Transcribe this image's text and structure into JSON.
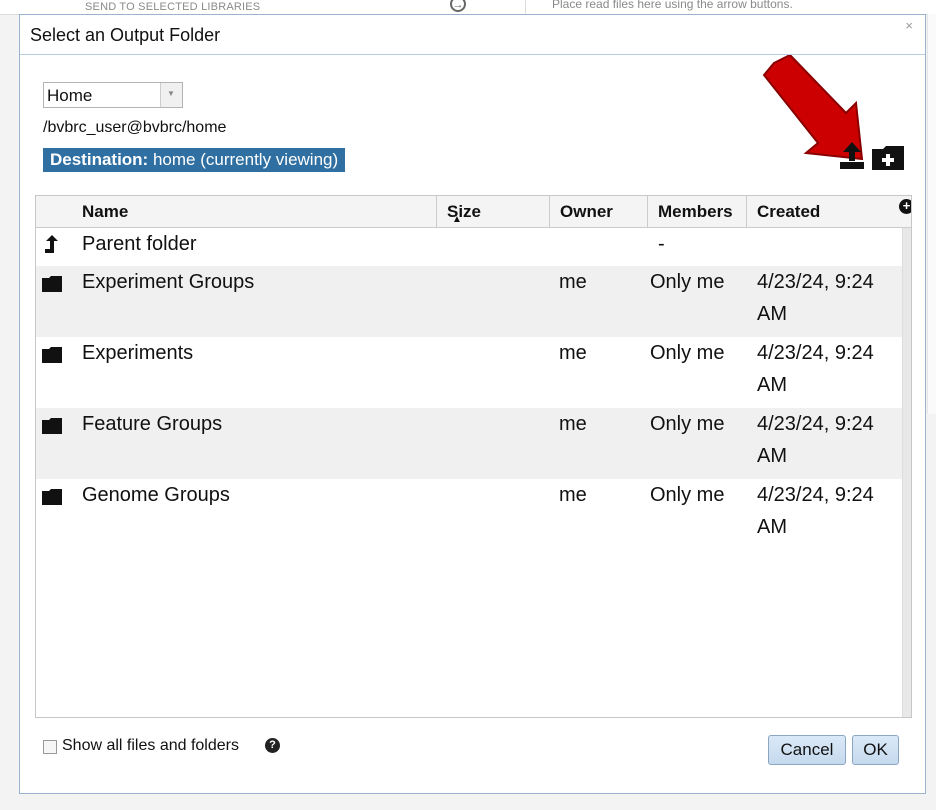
{
  "background": {
    "left_label": "SEND TO SELECTED LIBRARIES",
    "right_label": "Place read files here using the arrow buttons."
  },
  "dialog": {
    "title": "Select an Output Folder",
    "close_glyph": "×",
    "folder_select": {
      "value": "Home"
    },
    "path": "/bvbrc_user@bvbrc/home",
    "destination": {
      "label": "Destination:",
      "value": "home (currently viewing)"
    },
    "columns": [
      "Name",
      "Size",
      "Owner",
      "Members",
      "Created"
    ],
    "rows": [
      {
        "icon": "up-arrow-icon",
        "name": "Parent folder",
        "size": "",
        "owner": "",
        "members": "-",
        "created_1": "",
        "created_2": ""
      },
      {
        "icon": "folder-icon",
        "name": "Experiment Groups",
        "size": "",
        "owner": "me",
        "members": "Only me",
        "created_1": "4/23/24, 9:24",
        "created_2": "AM"
      },
      {
        "icon": "folder-icon",
        "name": "Experiments",
        "size": "",
        "owner": "me",
        "members": "Only me",
        "created_1": "4/23/24, 9:24",
        "created_2": "AM"
      },
      {
        "icon": "folder-icon",
        "name": "Feature Groups",
        "size": "",
        "owner": "me",
        "members": "Only me",
        "created_1": "4/23/24, 9:24",
        "created_2": "AM"
      },
      {
        "icon": "folder-icon",
        "name": "Genome Groups",
        "size": "",
        "owner": "me",
        "members": "Only me",
        "created_1": "4/23/24, 9:24",
        "created_2": "AM"
      }
    ],
    "show_all_label": "Show all files and folders",
    "help_glyph": "?",
    "cancel_label": "Cancel",
    "ok_label": "OK"
  },
  "colors": {
    "destination_bg": "#2f6fa1",
    "annotation_arrow": "#cc0000"
  }
}
